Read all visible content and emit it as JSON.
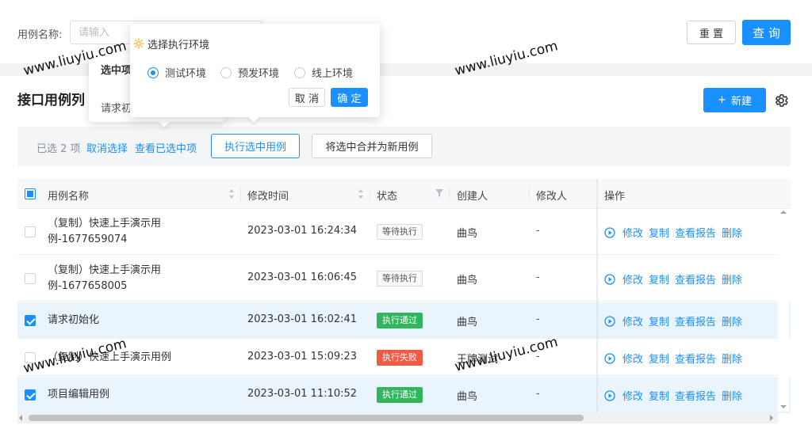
{
  "search": {
    "label": "用例名称:",
    "placeholder": "请输入",
    "reset_label": "重 置",
    "query_label": "查 询"
  },
  "section": {
    "title": "接口用例列",
    "new_label": "新建",
    "new_prefix": "+"
  },
  "selection_bar": {
    "count_text": "已选 2 项",
    "cancel_label": "取消选择",
    "view_label": "查看已选中项",
    "execute_label": "执行选中用例",
    "merge_label": "将选中合并为新用例"
  },
  "table": {
    "columns": {
      "name": "用例名称",
      "time": "修改时间",
      "status": "状态",
      "creator": "创建人",
      "modifier": "修改人",
      "actions": "操作"
    },
    "rows": [
      {
        "name": "（复制）快速上手演示用例-1677659074",
        "time": "2023-03-01 16:24:34",
        "status": "等待执行",
        "creator": "曲鸟",
        "modifier": "-",
        "checked": false
      },
      {
        "name": "（复制）快速上手演示用例-1677658005",
        "time": "2023-03-01 16:06:45",
        "status": "等待执行",
        "creator": "曲鸟",
        "modifier": "-",
        "checked": false
      },
      {
        "name": "请求初始化",
        "time": "2023-03-01 16:02:41",
        "status": "执行通过",
        "creator": "曲鸟",
        "modifier": "-",
        "checked": true
      },
      {
        "name": "（复制）快速上手演示用例",
        "time": "2023-03-01 15:09:23",
        "status": "执行失败",
        "creator": "王牌测试",
        "modifier": "-",
        "checked": false
      },
      {
        "name": "项目编辑用例",
        "time": "2023-03-01 11:10:52",
        "status": "执行通过",
        "creator": "曲鸟",
        "modifier": "-",
        "checked": true
      }
    ],
    "actions": {
      "edit": "修改",
      "copy": "复制",
      "report": "查看报告",
      "delete": "删除"
    }
  },
  "env_popover": {
    "title": "选择执行环境",
    "options": [
      "测试环境",
      "预发环境",
      "线上环境"
    ],
    "selected": "测试环境",
    "cancel_label": "取 消",
    "ok_label": "确 定"
  },
  "selected_popover": {
    "title": "选中项",
    "item": "请求初"
  },
  "watermarks": [
    "www.liuyiu.com",
    "www.liuyiu.com",
    "www.liuyiu.com",
    "www.liuyiu.com"
  ],
  "colors": {
    "primary": "#1890ff",
    "success": "#31b55d",
    "danger": "#ef5b45",
    "selected_row": "#e9f4fd"
  }
}
